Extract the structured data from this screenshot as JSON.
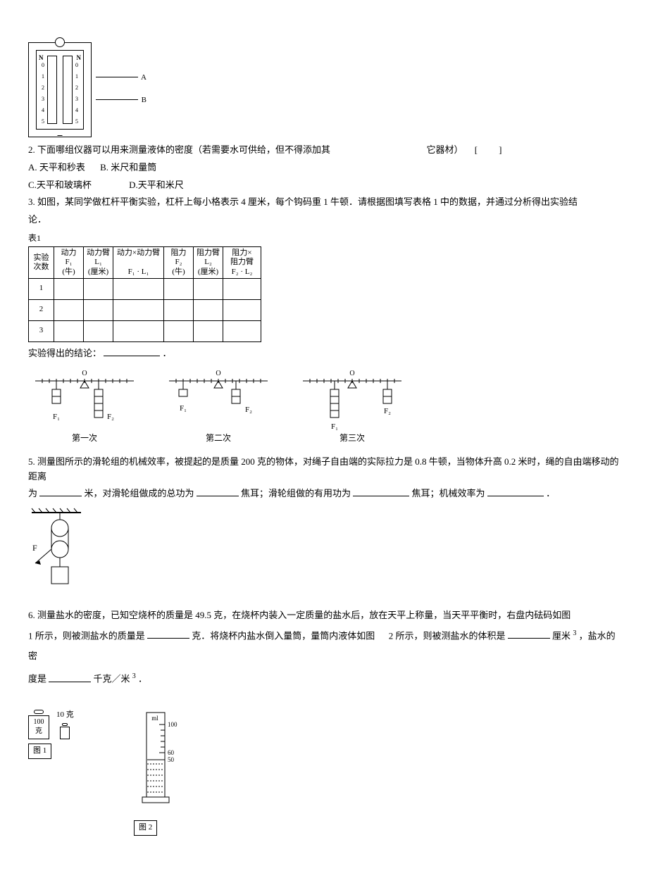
{
  "spring_figure": {
    "label_a": "A",
    "label_b": "B",
    "unit": "N",
    "scale": [
      "0",
      "1",
      "2",
      "3",
      "4",
      "5"
    ]
  },
  "q2": {
    "stem": "2.  下面哪组仪器可以用来测量液体的密度（若需要水可供给，但不得添加其",
    "stem_tail": "它器材）",
    "bracket_open": "[",
    "bracket_close": "]",
    "opt_a": "A. 天平和秒表",
    "opt_b": "B. 米尺和量筒",
    "opt_c": "C.天平和玻璃杯",
    "opt_d": "D.天平和米尺"
  },
  "q3": {
    "stem_line1": "3.  如图，某同学做杠杆平衡实验，杠杆上每小格表示 4 厘米，每个钩码重  1 牛顿．请根据图填写表格  1 中的数据，并通过分析得出实验结",
    "stem_line2": "论．",
    "table_label": "表1",
    "headers": {
      "exp": "实验\n次数",
      "f1": "动力\nF₁\n(牛)",
      "l1": "动力臂\nL₁\n(厘米)",
      "f1l1": "动力×动力臂\n\nF₁ · L₁",
      "f2": "阻力\nF₂\n(牛)",
      "l2": "阻力臂\nL₂\n(厘米)",
      "f2l2": "阻力×\n阻力臂\nF₂ · L₂"
    },
    "rows": [
      "1",
      "2",
      "3"
    ],
    "conclusion_label": "实验得出的结论：",
    "conclusion_tail": "．",
    "lever_labels": {
      "first": "第一次",
      "second": "第二次",
      "third": "第三次",
      "O": "O",
      "F1": "F₁",
      "F2": "F₂"
    }
  },
  "q5": {
    "line1a": "5. 测量图所示的滑轮组的机械效率，被提起的是质量 200 克的物体，对绳子自由端的实际拉力是 0.8 牛顿，当物体升高 0.2 米时，绳的自由端移动的距离",
    "line2a": "为 ",
    "line2b": "米，对滑轮组做成的总功为 ",
    "line2c": "焦耳；滑轮组做的有用功为 ",
    "line2d": "焦耳；机械效率为 ",
    "line2e": "．",
    "force_label": "F"
  },
  "q6": {
    "line1": "6.  测量盐水的密度，已知空烧杯的质量是 49.5 克，在烧杯内装入一定质量的盐水后，放在天平上称量，当天平平衡时，右盘内砝码如图",
    "line2a": "1 所示，则被测盐水的质量是  ",
    "line2b": " 克．将烧杯内盐水倒入量筒，量筒内液体如图",
    "line2c": "2 所示，则被测盐水的体积是  ",
    "line2d": " 厘米",
    "line2e": "，盐水的密",
    "sup3": "3",
    "line3a": "度是  ",
    "line3b": " 千克／米 ",
    "line3c": "．",
    "fig1": {
      "weight100": "100\n克",
      "weight10": "10 克",
      "caption": "图 1"
    },
    "fig2": {
      "unit": "ml",
      "tick100": "100",
      "tick60": "60",
      "tick50": "50",
      "caption": "图 2"
    }
  }
}
